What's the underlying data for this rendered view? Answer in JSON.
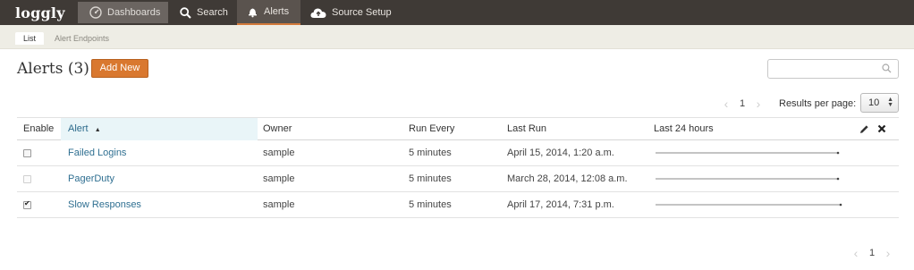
{
  "nav": {
    "logo": "loggly",
    "items": [
      {
        "label": "Dashboards",
        "icon": "dashboard-gauge-icon"
      },
      {
        "label": "Search",
        "icon": "search-icon"
      },
      {
        "label": "Alerts",
        "icon": "bell-icon"
      },
      {
        "label": "Source Setup",
        "icon": "cloud-upload-icon"
      }
    ]
  },
  "subnav": {
    "tabs": [
      {
        "label": "List",
        "active": true
      },
      {
        "label": "Alert Endpoints",
        "active": false
      }
    ]
  },
  "page": {
    "title": "Alerts (3)",
    "add_button": "Add New",
    "search_placeholder": ""
  },
  "pager": {
    "page": "1",
    "results_per_page_label": "Results per page:",
    "results_per_page_value": "10",
    "bottom_page": "1"
  },
  "table": {
    "columns": [
      "Enable",
      "Alert",
      "Owner",
      "Run Every",
      "Last Run",
      "Last 24 hours"
    ],
    "sorted_column": "Alert",
    "sort_direction": "ascending",
    "rows": [
      {
        "enabled": false,
        "disabled_checkbox": false,
        "alert": "Failed Logins",
        "owner": "sample",
        "run_every": "5 minutes",
        "last_run": "April 15, 2014, 1:20 a.m."
      },
      {
        "enabled": false,
        "disabled_checkbox": true,
        "alert": "PagerDuty",
        "owner": "sample",
        "run_every": "5 minutes",
        "last_run": "March 28, 2014, 12:08 a.m."
      },
      {
        "enabled": true,
        "disabled_checkbox": false,
        "alert": "Slow Responses",
        "owner": "sample",
        "run_every": "5 minutes",
        "last_run": "April 17, 2014, 7:31 p.m."
      }
    ]
  },
  "colors": {
    "topbar": "#3f3a36",
    "accent": "#d9782f",
    "link": "#2f6f91",
    "subbar": "#eeede5"
  }
}
